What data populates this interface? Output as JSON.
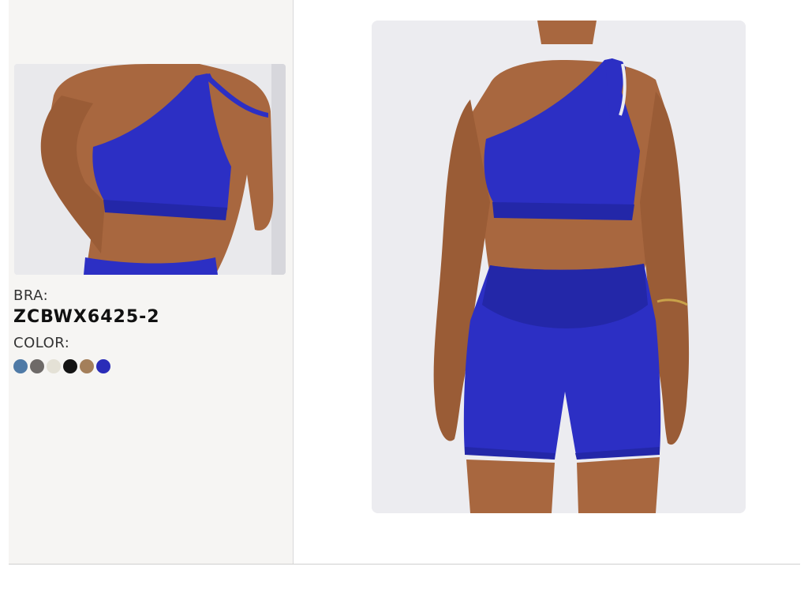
{
  "product": {
    "bra_label": "BRA:",
    "code": "ZCBWX6425-2",
    "color_label": "COLOR:"
  },
  "swatches": [
    {
      "name": "steel-blue",
      "color": "#4f7aa6"
    },
    {
      "name": "gray",
      "color": "#6e6a68"
    },
    {
      "name": "cream",
      "color": "#e4e1d6"
    },
    {
      "name": "black",
      "color": "#141414"
    },
    {
      "name": "tan",
      "color": "#a47f5a"
    },
    {
      "name": "royal-blue",
      "color": "#2a2cb8"
    }
  ],
  "colors": {
    "garment": "#2c2fc4",
    "skin": "#a8673f",
    "background": "#ececf0"
  }
}
